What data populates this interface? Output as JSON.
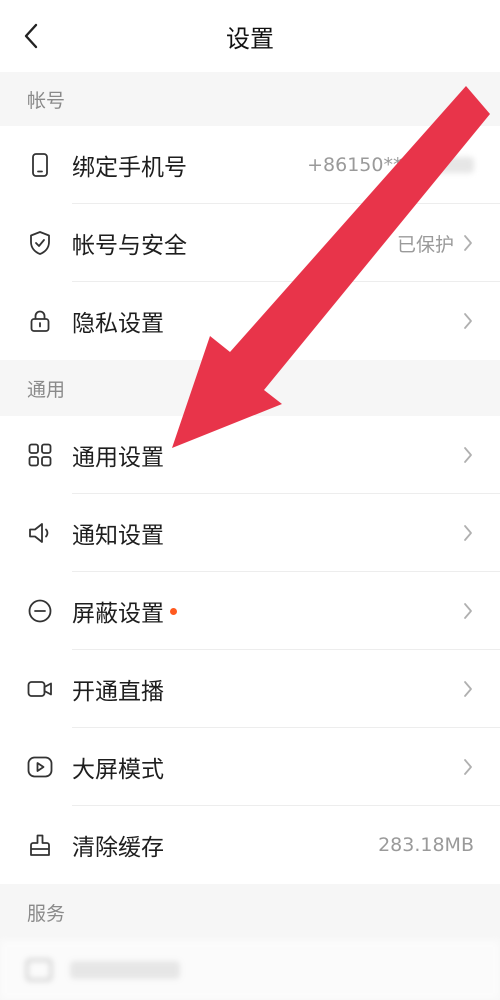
{
  "header": {
    "title": "设置"
  },
  "colors": {
    "accent_arrow": "#e8344a",
    "badge_dot": "#ff5a1f"
  },
  "sections": {
    "account": {
      "label": "帐号",
      "items": [
        {
          "label": "绑定手机号",
          "value": "+86150***",
          "icon": "phone-icon"
        },
        {
          "label": "帐号与安全",
          "value": "已保护",
          "icon": "shield-icon"
        },
        {
          "label": "隐私设置",
          "value": "",
          "icon": "lock-icon"
        }
      ]
    },
    "general": {
      "label": "通用",
      "items": [
        {
          "label": "通用设置",
          "value": "",
          "icon": "grid-icon"
        },
        {
          "label": "通知设置",
          "value": "",
          "icon": "speaker-icon"
        },
        {
          "label": "屏蔽设置",
          "value": "",
          "icon": "block-icon",
          "badge": true
        },
        {
          "label": "开通直播",
          "value": "",
          "icon": "video-camera-icon"
        },
        {
          "label": "大屏模式",
          "value": "",
          "icon": "play-screen-icon"
        },
        {
          "label": "清除缓存",
          "value": "283.18MB",
          "icon": "broom-icon"
        }
      ]
    },
    "service": {
      "label": "服务"
    }
  }
}
